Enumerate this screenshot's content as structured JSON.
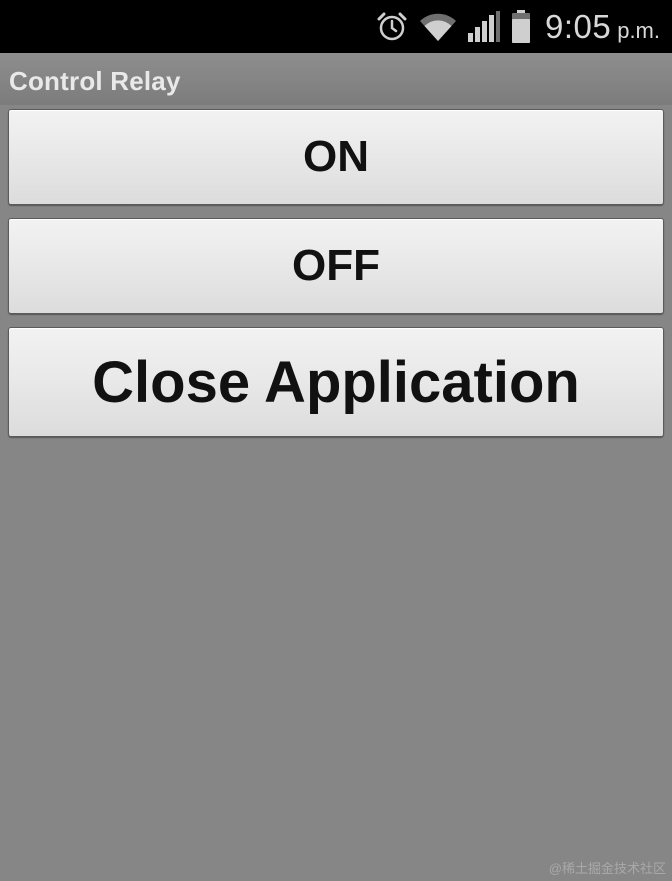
{
  "status_bar": {
    "icons": [
      "alarm-icon",
      "wifi-icon",
      "signal-icon",
      "battery-icon"
    ],
    "time": "9:05",
    "ampm": "p.m."
  },
  "app": {
    "title": "Control Relay"
  },
  "buttons": {
    "on_label": "ON",
    "off_label": "OFF",
    "close_label": "Close Application"
  },
  "watermark": "@稀土掘金技术社区",
  "colors": {
    "status_bar_bg": "#000000",
    "background": "#868686",
    "button_bg": "#e9e9e9",
    "button_text": "#111111",
    "title_text": "#e9e9e9"
  }
}
